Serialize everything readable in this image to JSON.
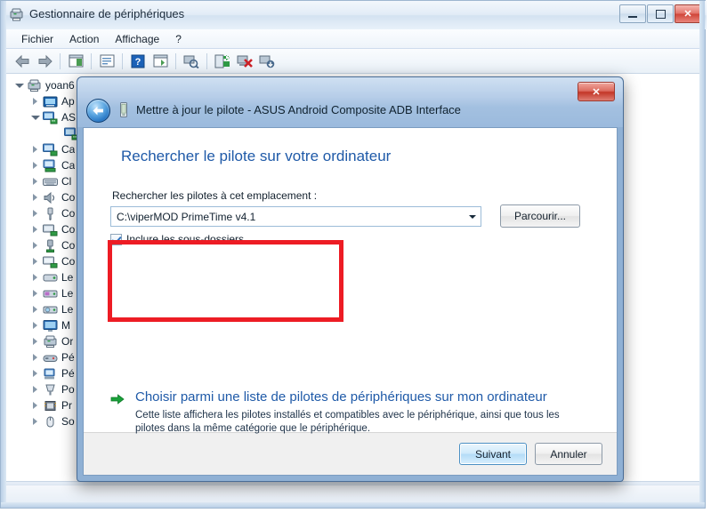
{
  "main_window": {
    "title": "Gestionnaire de périphériques",
    "icon": "device-manager-icon",
    "controls": {
      "minimize": "minimize-button",
      "maximize": "maximize-button",
      "close_label": "✕"
    },
    "menus": [
      {
        "label": "Fichier"
      },
      {
        "label": "Action"
      },
      {
        "label": "Affichage"
      },
      {
        "label": "?"
      }
    ],
    "toolbar": [
      {
        "name": "back-arrow-icon",
        "glyph": "⬅"
      },
      {
        "name": "forward-arrow-icon",
        "glyph": "➡"
      },
      {
        "name": "sep",
        "glyph": ""
      },
      {
        "name": "show-hide-console-tree-icon",
        "glyph": "▤"
      },
      {
        "name": "sep",
        "glyph": ""
      },
      {
        "name": "properties-icon",
        "glyph": "▣"
      },
      {
        "name": "sep",
        "glyph": ""
      },
      {
        "name": "help-icon",
        "glyph": "?"
      },
      {
        "name": "show-hide-action-pane-icon",
        "glyph": "▥"
      },
      {
        "name": "sep",
        "glyph": ""
      },
      {
        "name": "scan-hardware-changes-icon",
        "glyph": "⌕"
      },
      {
        "name": "sep",
        "glyph": ""
      },
      {
        "name": "update-driver-icon",
        "glyph": "⇪"
      },
      {
        "name": "uninstall-device-icon",
        "glyph": "✖"
      },
      {
        "name": "disable-device-icon",
        "glyph": "⇩"
      }
    ],
    "tree": [
      {
        "level": 0,
        "label": "yoan6",
        "expander": "open",
        "icon": "computer-icon"
      },
      {
        "level": 1,
        "label": "Ap",
        "expander": "closed",
        "icon": "imaging-device-icon"
      },
      {
        "level": 1,
        "label": "AS",
        "expander": "open",
        "icon": "adb-device-icon"
      },
      {
        "level": 2,
        "label": "",
        "expander": "none",
        "icon": "adb-device-icon"
      },
      {
        "level": 1,
        "label": "Ca",
        "expander": "closed",
        "icon": "network-adapter-icon"
      },
      {
        "level": 1,
        "label": "Ca",
        "expander": "closed",
        "icon": "display-adapter-icon"
      },
      {
        "level": 1,
        "label": "Cl",
        "expander": "closed",
        "icon": "keyboard-icon"
      },
      {
        "level": 1,
        "label": "Co",
        "expander": "closed",
        "icon": "sound-icon"
      },
      {
        "level": 1,
        "label": "Co",
        "expander": "closed",
        "icon": "usb-controller-icon"
      },
      {
        "level": 1,
        "label": "Co",
        "expander": "closed",
        "icon": "ide-controller-icon"
      },
      {
        "level": 1,
        "label": "Co",
        "expander": "closed",
        "icon": "usb-host-controller-icon"
      },
      {
        "level": 1,
        "label": "Co",
        "expander": "closed",
        "icon": "storage-controller-icon"
      },
      {
        "level": 1,
        "label": "Le",
        "expander": "closed",
        "icon": "disk-drive-icon"
      },
      {
        "level": 1,
        "label": "Le",
        "expander": "closed",
        "icon": "floppy-drive-icon"
      },
      {
        "level": 1,
        "label": "Le",
        "expander": "closed",
        "icon": "dvd-drive-icon"
      },
      {
        "level": 1,
        "label": "M",
        "expander": "closed",
        "icon": "monitor-icon"
      },
      {
        "level": 1,
        "label": "Or",
        "expander": "closed",
        "icon": "computer-icon"
      },
      {
        "level": 1,
        "label": "Pé",
        "expander": "closed",
        "icon": "game-controller-icon"
      },
      {
        "level": 1,
        "label": "Pé",
        "expander": "closed",
        "icon": "system-device-icon"
      },
      {
        "level": 1,
        "label": "Po",
        "expander": "closed",
        "icon": "port-icon"
      },
      {
        "level": 1,
        "label": "Pr",
        "expander": "closed",
        "icon": "processor-icon"
      },
      {
        "level": 1,
        "label": "So",
        "expander": "closed",
        "icon": "mouse-icon"
      }
    ]
  },
  "dialog": {
    "title": "Mettre à jour le pilote - ASUS Android Composite ADB Interface",
    "back_button": "back-button",
    "close_label": "✕",
    "heading": "Rechercher le pilote sur votre ordinateur",
    "location_label": "Rechercher les pilotes à cet emplacement :",
    "location_value": "C:\\viperMOD PrimeTime v4.1",
    "location_placeholder": "C:\\",
    "browse_label": "Parcourir...",
    "subfolders_label": "Inclure les sous-dossiers",
    "subfolders_checked": true,
    "option": {
      "title": "Choisir parmi une liste de pilotes de périphériques sur mon ordinateur",
      "description": "Cette liste affichera les pilotes installés et compatibles avec le périphérique, ainsi que tous les pilotes dans la même catégorie que le périphérique."
    },
    "next_label": "Suivant",
    "cancel_label": "Annuler",
    "highlight_color": "#ed1c24",
    "heading_color": "#1f5aa8"
  }
}
